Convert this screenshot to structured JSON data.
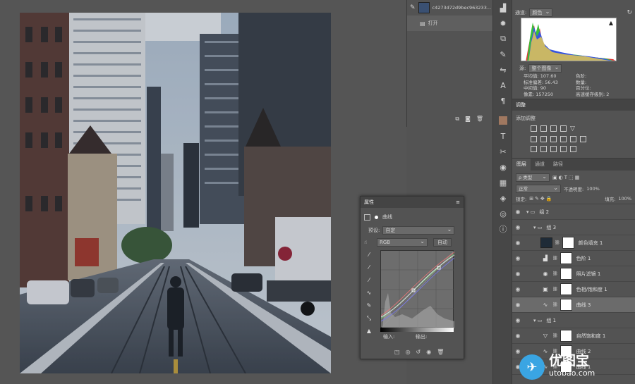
{
  "history": {
    "snapshot_name": "c4273d72d9bec963233...",
    "items": [
      {
        "label": "打开"
      }
    ]
  },
  "histogram": {
    "channel_label": "通道:",
    "channel_value": "颜色",
    "source_label": "源:",
    "source_value": "整个图像",
    "stats": [
      {
        "label": "平均值:",
        "value": "107.60"
      },
      {
        "label": "色阶:",
        "value": ""
      },
      {
        "label": "标准偏差:",
        "value": "56.43"
      },
      {
        "label": "数量:",
        "value": ""
      },
      {
        "label": "中间值:",
        "value": "90"
      },
      {
        "label": "百分位:",
        "value": ""
      },
      {
        "label": "像素:",
        "value": "157250"
      },
      {
        "label": "高速缓存级别:",
        "value": "2"
      }
    ]
  },
  "adjustments": {
    "tab": "调整",
    "add_label": "添加调整"
  },
  "layers": {
    "tabs": [
      "图层",
      "通道",
      "路径"
    ],
    "filter_label": "ρ 类型",
    "blend_mode": "正常",
    "opacity_label": "不透明度:",
    "opacity_value": "100%",
    "lock_label": "锁定:",
    "fill_label": "填充:",
    "fill_value": "100%",
    "rows": [
      {
        "name": "组 2",
        "kind": "group",
        "indent": 0
      },
      {
        "name": "组 3",
        "kind": "group",
        "indent": 1
      },
      {
        "name": "颜色填充 1",
        "kind": "fill",
        "indent": 2
      },
      {
        "name": "色阶 1",
        "kind": "levels",
        "indent": 2
      },
      {
        "name": "照片滤镜 1",
        "kind": "photo",
        "indent": 2
      },
      {
        "name": "色相/饱和度 1",
        "kind": "hue",
        "indent": 2
      },
      {
        "name": "曲线 3",
        "kind": "curves",
        "indent": 2,
        "selected": true
      },
      {
        "name": "组 1",
        "kind": "group",
        "indent": 1
      },
      {
        "name": "自然饱和度 1",
        "kind": "vib",
        "indent": 2
      },
      {
        "name": "曲线 2",
        "kind": "curves",
        "indent": 2
      },
      {
        "name": "曲线 1",
        "kind": "curves",
        "indent": 2
      }
    ]
  },
  "properties": {
    "tab": "属性",
    "title": "曲线",
    "preset_label": "预设:",
    "preset_value": "自定",
    "channel_value": "RGB",
    "auto_button": "自动",
    "input_label": "输入:",
    "output_label": "输出:"
  },
  "watermark": {
    "text": "优图宝",
    "url": "utobao.com"
  }
}
